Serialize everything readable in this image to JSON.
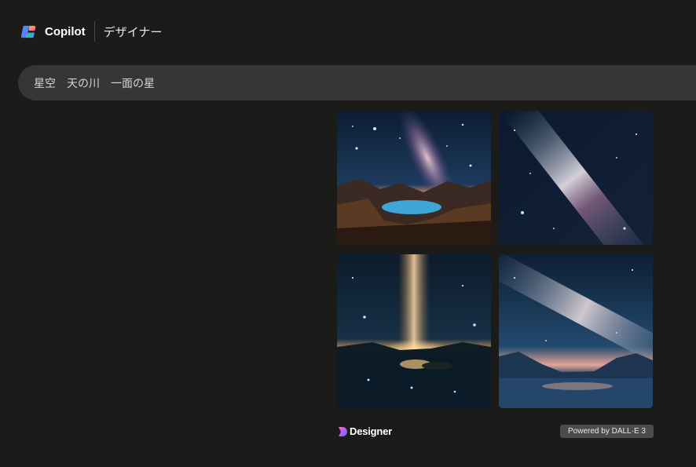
{
  "header": {
    "brand": "Copilot",
    "section": "デザイナー",
    "logo_icon": "copilot-logo-icon"
  },
  "prompt": {
    "text": "星空　天の川　一面の星"
  },
  "gallery": {
    "images": [
      {
        "subject": "milky-way-over-mountain-lake"
      },
      {
        "subject": "milky-way-starfield"
      },
      {
        "subject": "milky-way-over-glowing-lake"
      },
      {
        "subject": "milky-way-over-mountain-horizon"
      }
    ]
  },
  "footer": {
    "designer_label": "Designer",
    "designer_icon": "designer-logo-icon",
    "powered_by": "Powered by DALL·E 3"
  },
  "colors": {
    "background": "#1b1b1a",
    "prompt_bar": "#363636",
    "badge": "#4b4b4b",
    "text_primary": "#ffffff"
  }
}
